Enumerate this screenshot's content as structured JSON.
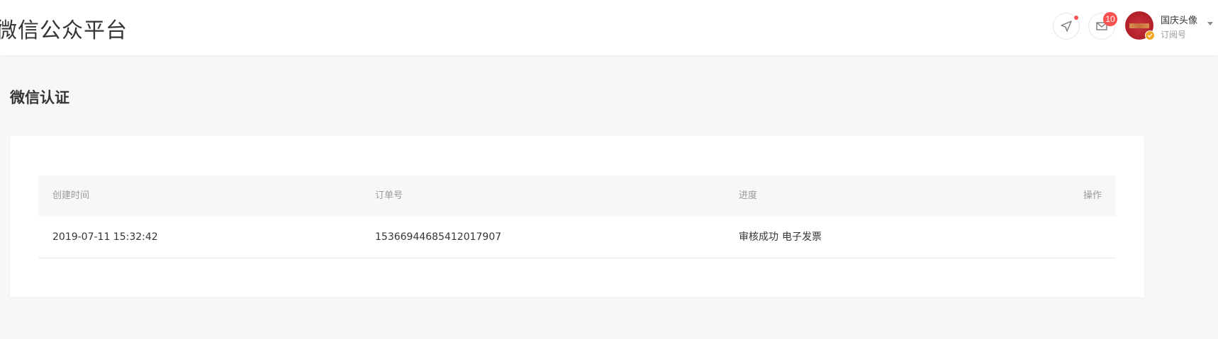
{
  "header": {
    "brand": "微信公众平台",
    "notify_button_icon": "send-icon",
    "mail_button_icon": "mail-icon",
    "mail_badge_count": "10",
    "account": {
      "name": "国庆头像",
      "type": "订阅号",
      "verified": true
    }
  },
  "page": {
    "title": "微信认证"
  },
  "table": {
    "columns": [
      "创建时间",
      "订单号",
      "进度",
      "操作"
    ],
    "rows": [
      {
        "created_at": "2019-07-11 15:32:42",
        "order_no": "15366944685412017907",
        "status": "审核成功",
        "invoice_link": "电子发票",
        "action": ""
      }
    ]
  },
  "colors": {
    "background": "#f6f7f9",
    "badge": "#fa5151",
    "verify": "#f2a623",
    "text": "#353535",
    "muted": "#9a9a9a"
  }
}
